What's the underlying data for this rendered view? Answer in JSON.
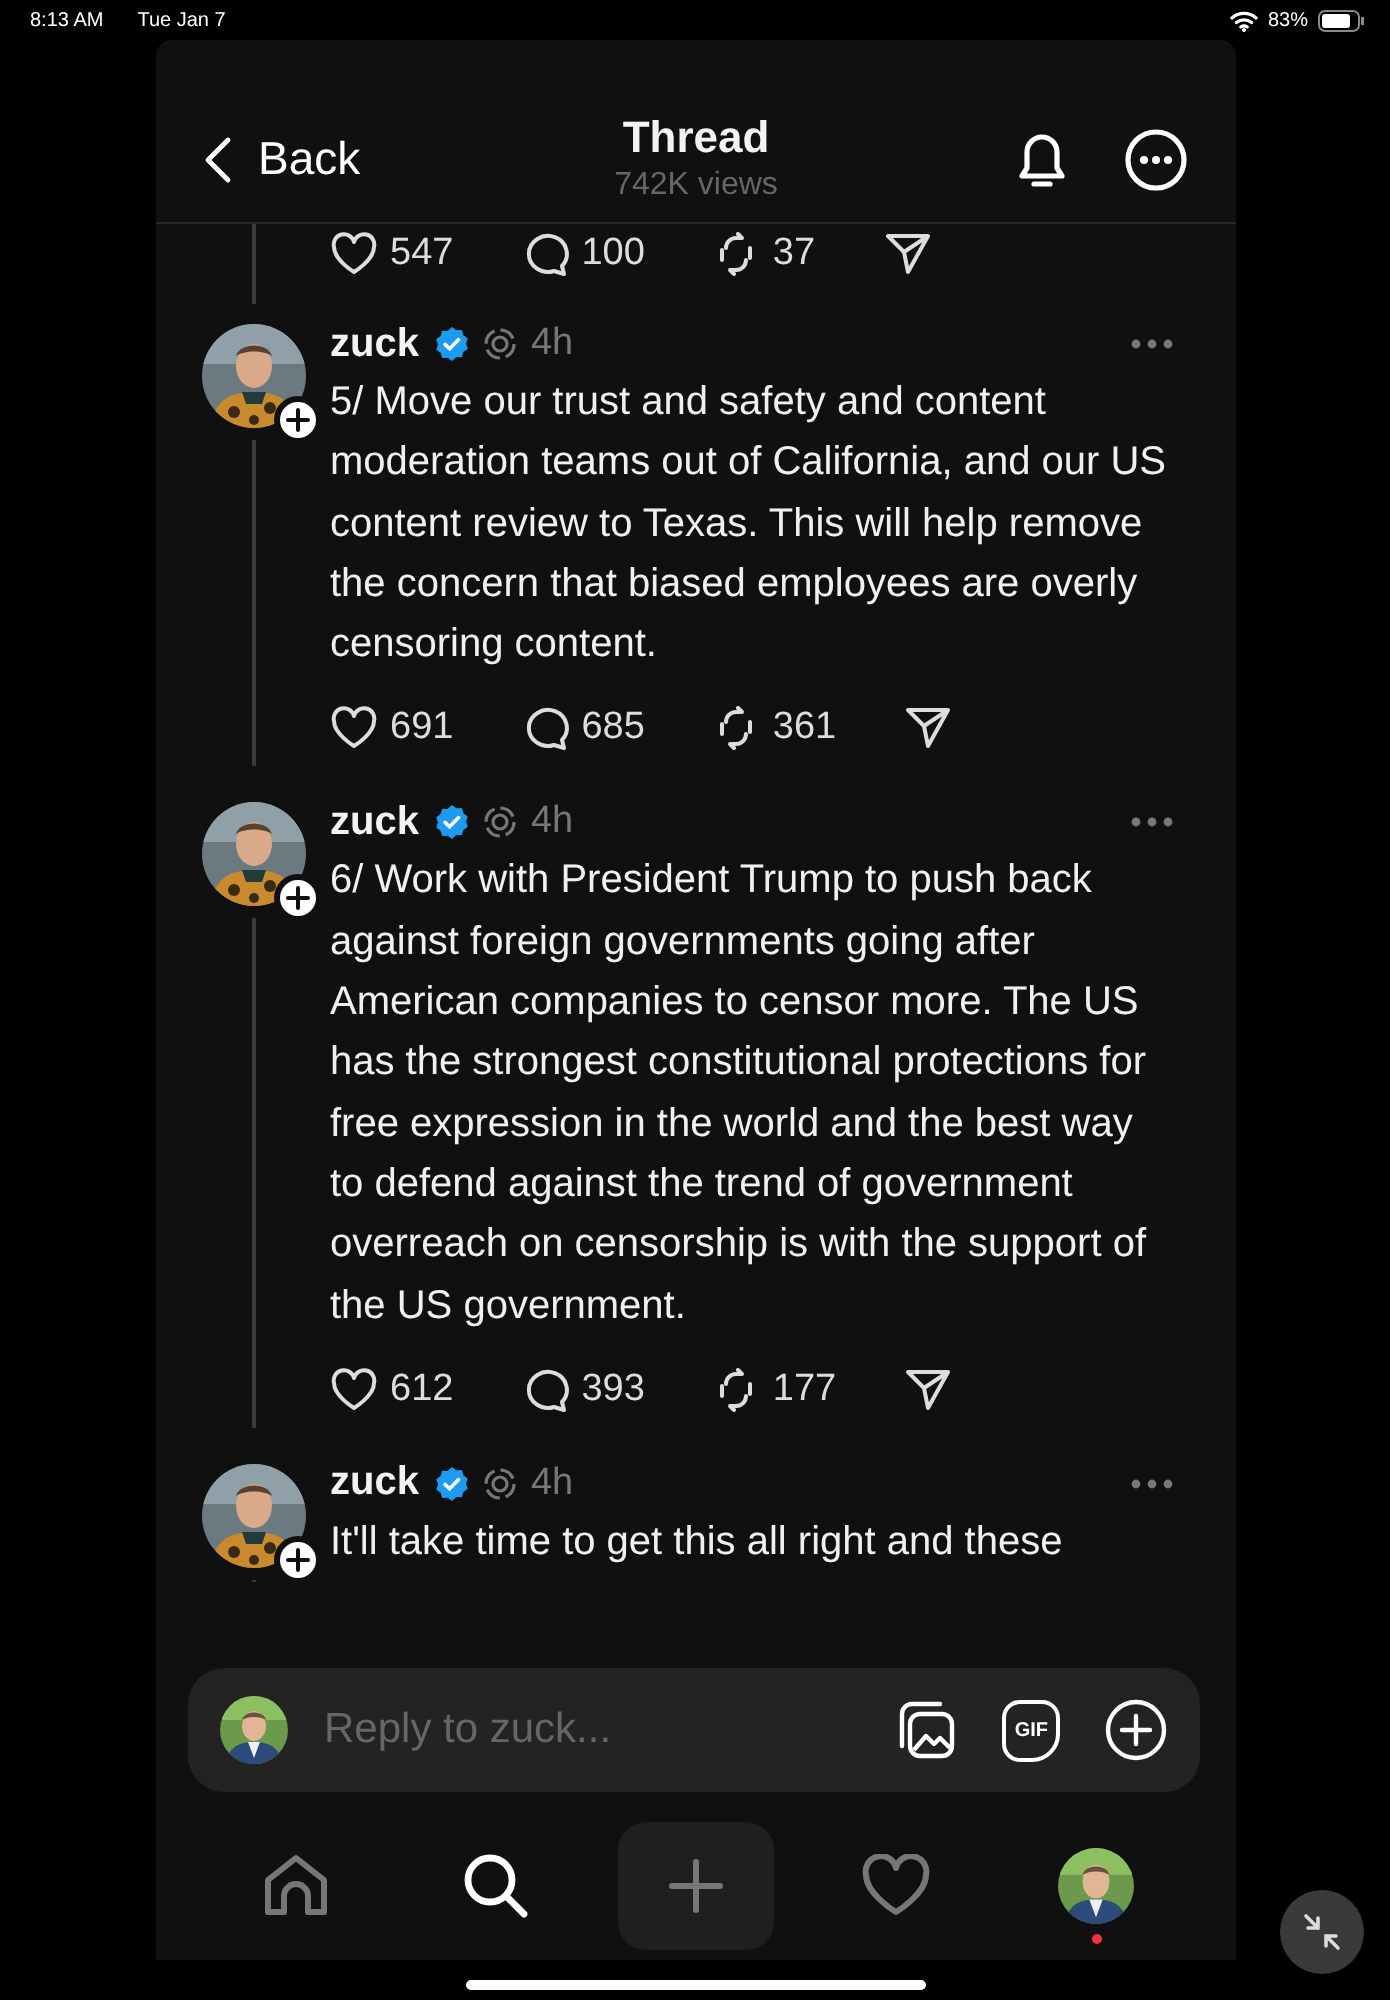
{
  "status_bar": {
    "time": "8:13 AM",
    "date": "Tue Jan 7",
    "battery": "83%"
  },
  "header": {
    "back": "Back",
    "title": "Thread",
    "views": "742K views"
  },
  "previous_post_stats": {
    "likes": "547",
    "replies": "100",
    "reposts": "37"
  },
  "posts": [
    {
      "author": "zuck",
      "verified": true,
      "time": "4h",
      "text": "5/ Move our trust and safety and content moderation teams out of California, and our US content review to Texas. This will help remove the concern that biased employees are overly censoring content.",
      "stats": {
        "likes": "691",
        "replies": "685",
        "reposts": "361"
      }
    },
    {
      "author": "zuck",
      "verified": true,
      "time": "4h",
      "text": "6/ Work with President Trump to push back against foreign governments going after American companies to censor more. The US has the strongest constitutional protections for free expression in the world and the best way to defend against the trend of government overreach on censorship is with the support of the US government.",
      "stats": {
        "likes": "612",
        "replies": "393",
        "reposts": "177"
      }
    },
    {
      "author": "zuck",
      "verified": true,
      "time": "4h",
      "text": "It'll take time to get this all right and these"
    }
  ],
  "reply_bar": {
    "placeholder": "Reply to zuck...",
    "gif_label": "GIF"
  },
  "nav": [
    {
      "kind": "home",
      "selected": false
    },
    {
      "kind": "search",
      "selected": true
    },
    {
      "kind": "create",
      "selected": false
    },
    {
      "kind": "activity",
      "selected": false
    },
    {
      "kind": "profile",
      "selected": false,
      "notification": true
    }
  ]
}
